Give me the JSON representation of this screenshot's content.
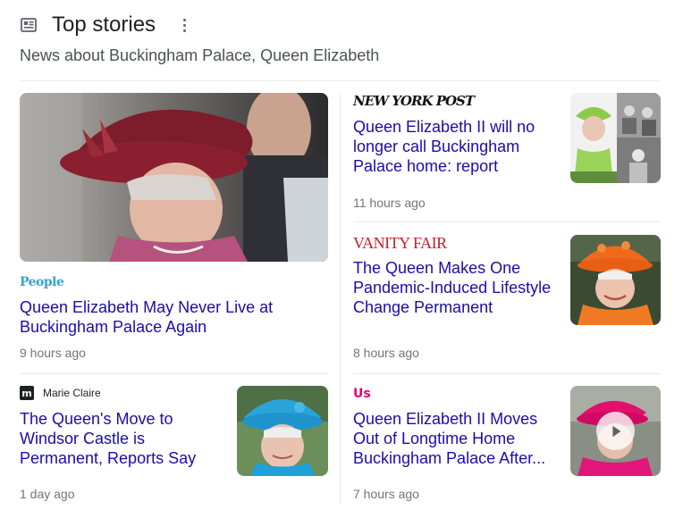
{
  "header": {
    "icon": "newspaper-icon",
    "title": "Top stories",
    "more_icon": "more-vert-icon"
  },
  "subtitle": "News about Buckingham Palace, Queen Elizabeth",
  "colors": {
    "link": "#1a0dab",
    "meta": "#70757a",
    "divider": "#e8eaed"
  },
  "stories": [
    {
      "source": "People",
      "headline": "Queen Elizabeth May Never Live at Buckingham Palace Again",
      "time": "9 hours ago"
    },
    {
      "source": "NEW YORK POST",
      "headline": "Queen Elizabeth II will no longer call Buckingham Palace home: report",
      "time": "11 hours ago"
    },
    {
      "source": "VANITY FAIR",
      "headline": "The Queen Makes One Pandemic-Induced Lifestyle Change Permanent",
      "time": "8 hours ago"
    },
    {
      "source_logo": "m",
      "source": "Marie Claire",
      "headline": "The Queen's Move to Windsor Castle is Permanent, Reports Say",
      "time": "1 day ago"
    },
    {
      "source": "Us",
      "headline": "Queen Elizabeth II Moves Out of Longtime Home Buckingham Palace After...",
      "time": "7 hours ago",
      "thumb_icon": "play-icon"
    }
  ]
}
